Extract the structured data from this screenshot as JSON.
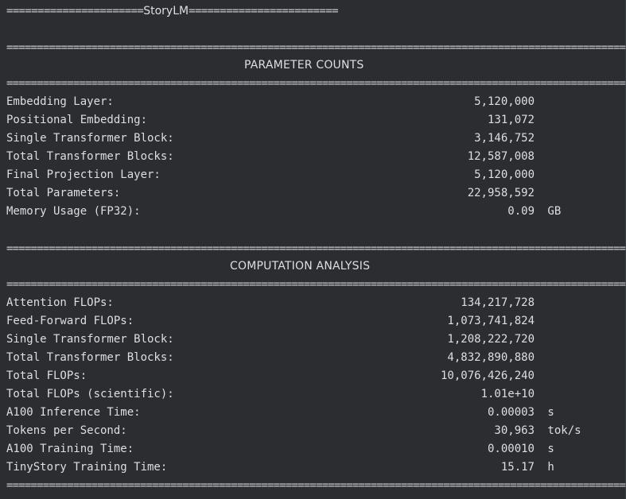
{
  "banner": {
    "left": "======================",
    "title": "StoryLM",
    "right": "========================"
  },
  "separator": "======================================================================================================",
  "parameter_counts": {
    "heading": "PARAMETER COUNTS",
    "rows": [
      {
        "label": "Embedding Layer:",
        "value": "5,120,000",
        "unit": ""
      },
      {
        "label": "Positional Embedding:",
        "value": "131,072",
        "unit": ""
      },
      {
        "label": "Single Transformer Block:",
        "value": "3,146,752",
        "unit": ""
      },
      {
        "label": "Total Transformer Blocks:",
        "value": "12,587,008",
        "unit": ""
      },
      {
        "label": "Final Projection Layer:",
        "value": "5,120,000",
        "unit": ""
      },
      {
        "label": "Total Parameters:",
        "value": "22,958,592",
        "unit": ""
      },
      {
        "label": "Memory Usage (FP32):",
        "value": "0.09",
        "unit": " GB"
      }
    ]
  },
  "computation_analysis": {
    "heading": "COMPUTATION ANALYSIS",
    "rows": [
      {
        "label": "Attention FLOPs:",
        "value": "134,217,728",
        "unit": ""
      },
      {
        "label": "Feed-Forward FLOPs:",
        "value": "1,073,741,824",
        "unit": ""
      },
      {
        "label": "Single Transformer Block:",
        "value": "1,208,222,720",
        "unit": ""
      },
      {
        "label": "Total Transformer Blocks:",
        "value": "4,832,890,880",
        "unit": ""
      },
      {
        "label": "Total FLOPs:",
        "value": "10,076,426,240",
        "unit": ""
      },
      {
        "label": "Total FLOPs (scientific):",
        "value": "1.01e+10",
        "unit": ""
      },
      {
        "label": "A100 Inference Time:",
        "value": "0.00003",
        "unit": " s"
      },
      {
        "label": "Tokens per Second:",
        "value": "30,963",
        "unit": " tok/s"
      },
      {
        "label": "A100 Training Time:",
        "value": "0.00010",
        "unit": " s"
      },
      {
        "label": "TinyStory Training Time:",
        "value": "15.17",
        "unit": " h"
      }
    ]
  }
}
